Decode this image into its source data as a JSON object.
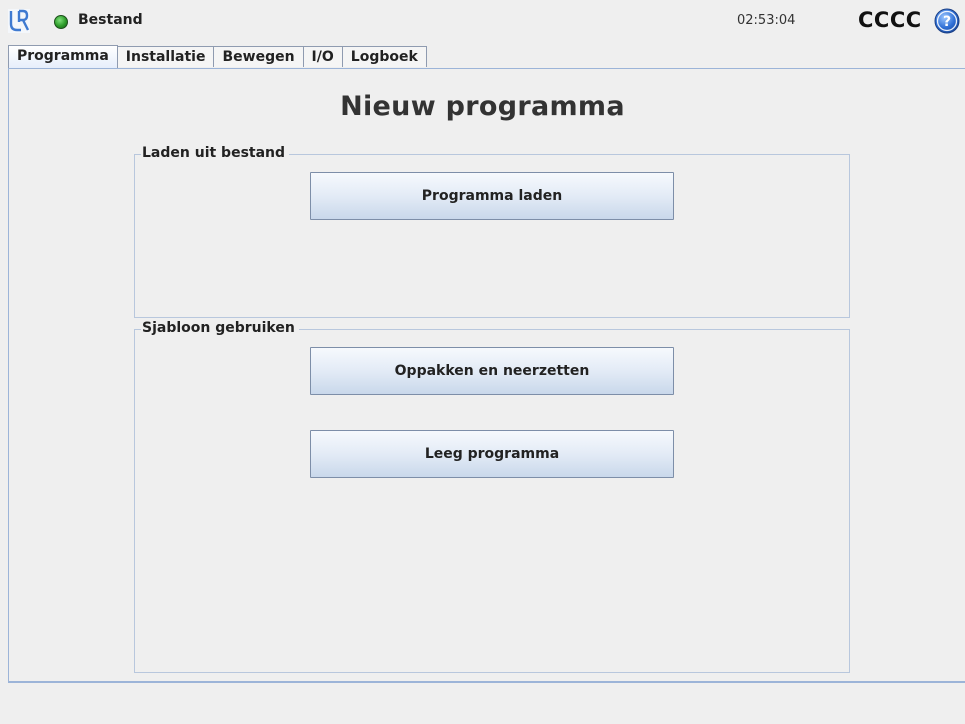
{
  "topbar": {
    "menu_label": "Bestand",
    "clock": "02:53:04",
    "robot_name": "CCCC"
  },
  "tabs": [
    {
      "label": "Programma",
      "active": true
    },
    {
      "label": "Installatie",
      "active": false
    },
    {
      "label": "Bewegen",
      "active": false
    },
    {
      "label": "I/O",
      "active": false
    },
    {
      "label": "Logboek",
      "active": false
    }
  ],
  "main": {
    "title": "Nieuw programma",
    "load_group": {
      "label": "Laden uit bestand",
      "load_button": "Programma laden"
    },
    "template_group": {
      "label": "Sjabloon gebruiken",
      "pick_place_button": "Oppakken en neerzetten",
      "empty_program_button": "Leeg programma"
    }
  },
  "colors": {
    "accent_line": "#9cb4d8",
    "status_ok": "#2d9c2a",
    "help_blue": "#2f6fd6"
  }
}
